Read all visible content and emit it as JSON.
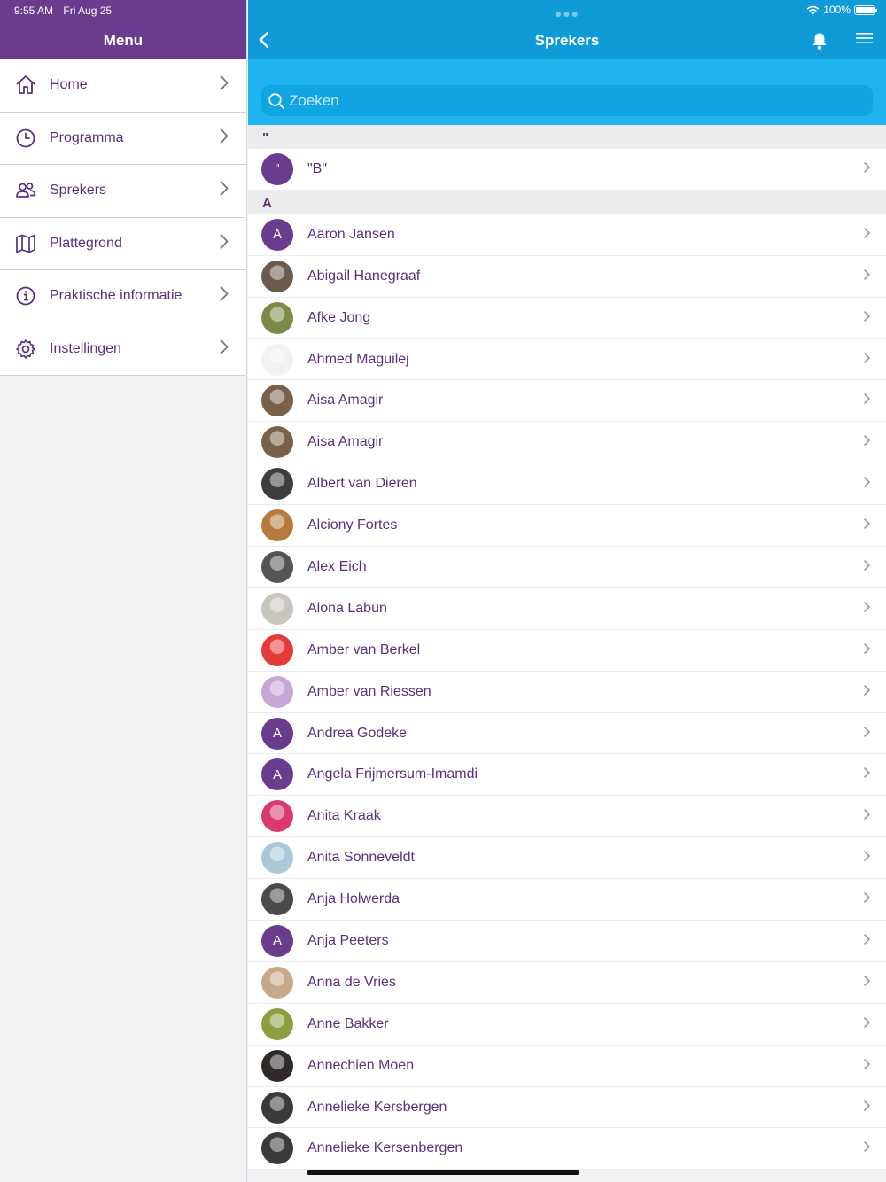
{
  "status": {
    "time": "9:55 AM",
    "date": "Fri Aug 25",
    "battery": "100%"
  },
  "sidebar": {
    "title": "Menu",
    "items": [
      {
        "label": "Home",
        "icon": "home-icon"
      },
      {
        "label": "Programma",
        "icon": "clock-icon"
      },
      {
        "label": "Sprekers",
        "icon": "people-icon"
      },
      {
        "label": "Plattegrond",
        "icon": "map-icon"
      },
      {
        "label": "Praktische informatie",
        "icon": "info-icon"
      },
      {
        "label": "Instellingen",
        "icon": "gear-icon"
      }
    ]
  },
  "header": {
    "title": "Sprekers"
  },
  "search": {
    "placeholder": "Zoeken"
  },
  "sections": [
    {
      "letter": "\"",
      "items": [
        {
          "name": "\"B\"",
          "initial": "\""
        }
      ]
    },
    {
      "letter": "A",
      "items": [
        {
          "name": "Aäron Jansen",
          "initial": "A"
        },
        {
          "name": "Abigail Hanegraaf",
          "photo": "#6b5a4e"
        },
        {
          "name": "Afke Jong",
          "photo": "#7b8a46"
        },
        {
          "name": "Ahmed Maguilej",
          "photo": "#f2f2f2"
        },
        {
          "name": "Aisa Amagir",
          "photo": "#7a6048"
        },
        {
          "name": "Aisa Amagir",
          "photo": "#7a6048"
        },
        {
          "name": "Albert van Dieren",
          "photo": "#3d3d3d"
        },
        {
          "name": "Alciony Fortes",
          "photo": "#b57a3c"
        },
        {
          "name": "Alex Eich",
          "photo": "#555555"
        },
        {
          "name": "Alona Labun",
          "photo": "#c8c4be"
        },
        {
          "name": "Amber van Berkel",
          "photo": "#e53a3a"
        },
        {
          "name": "Amber van Riessen",
          "photo": "#c9a6d8"
        },
        {
          "name": "Andrea Godeke",
          "initial": "A"
        },
        {
          "name": "Angela Frijmersum-Imamdi",
          "initial": "A"
        },
        {
          "name": "Anita Kraak",
          "photo": "#d93b6e"
        },
        {
          "name": "Anita Sonneveldt",
          "photo": "#a9c8d8"
        },
        {
          "name": "Anja Holwerda",
          "photo": "#4a4a4a"
        },
        {
          "name": "Anja Peeters",
          "initial": "A"
        },
        {
          "name": "Anna de Vries",
          "photo": "#c8a888"
        },
        {
          "name": "Anne Bakker",
          "photo": "#8aa040"
        },
        {
          "name": "Annechien Moen",
          "photo": "#2f2a28"
        },
        {
          "name": "Annelieke Kersbergen",
          "photo": "#3a3a3a"
        },
        {
          "name": "Annelieke Kersenbergen",
          "photo": "#3a3a3a"
        }
      ]
    }
  ],
  "colors": {
    "purple": "#6b3b8e",
    "blue": "#0f9ad8",
    "search_blue": "#1fb3f0"
  }
}
